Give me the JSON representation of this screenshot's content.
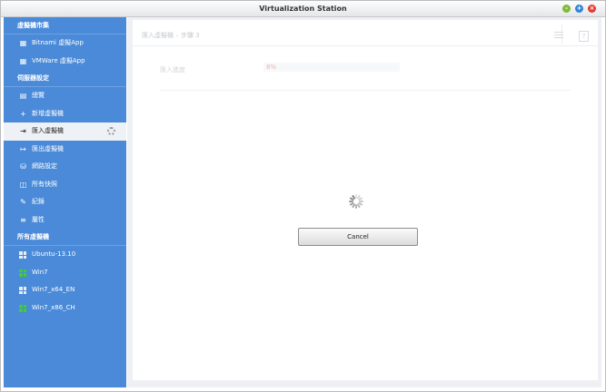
{
  "window": {
    "title": "Virtualization Station"
  },
  "sidebar": {
    "section_vm_store": "虛擬機市集",
    "store_items": [
      {
        "label": "Bitnami 虛擬App",
        "icon": "app-store-icon"
      },
      {
        "label": "VMWare 虛擬App",
        "icon": "app-store-icon"
      }
    ],
    "section_server_settings": "伺服器設定",
    "settings_items": [
      {
        "label": "總覽",
        "icon": "overview-icon"
      },
      {
        "label": "新增虛擬機",
        "icon": "plus-icon"
      },
      {
        "label": "匯入虛擬機",
        "icon": "import-icon",
        "active": true
      },
      {
        "label": "匯出虛擬機",
        "icon": "export-icon"
      },
      {
        "label": "網路設定",
        "icon": "network-icon"
      },
      {
        "label": "所有快照",
        "icon": "snapshot-icon"
      },
      {
        "label": "紀錄",
        "icon": "log-icon"
      },
      {
        "label": "屬性",
        "icon": "properties-icon"
      }
    ],
    "section_all_vms": "所有虛擬機",
    "vms": [
      {
        "label": "Ubuntu-13.10",
        "running": false
      },
      {
        "label": "Win7",
        "running": true
      },
      {
        "label": "Win7_x64_EN",
        "running": false
      },
      {
        "label": "Win7_x86_CH",
        "running": true
      }
    ]
  },
  "main": {
    "panel_title": "匯入虛擬機 – 步驟 3",
    "field_label": "匯入進度",
    "field_value": "8%",
    "cancel_label": "Cancel"
  },
  "colors": {
    "sidebar_bg": "#4a8ad8",
    "running_vm": "#3fce2c",
    "close": "#e2392f"
  }
}
